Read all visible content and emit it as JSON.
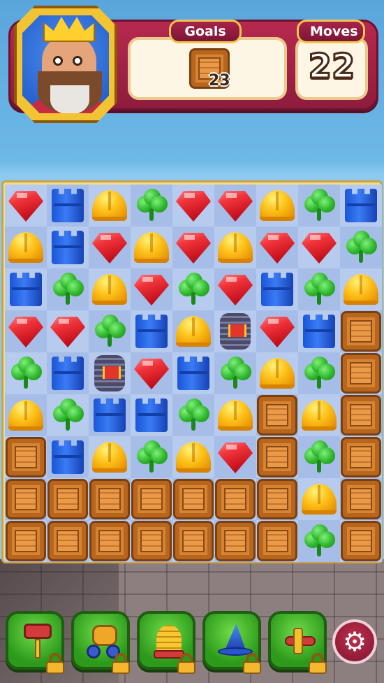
{
  "header": {
    "goals_label": "Goals",
    "moves_label": "Moves",
    "goal_count": "23",
    "moves_value": "22",
    "goal_item": "wooden-crate"
  },
  "board": {
    "legend": {
      "R": "red-gem",
      "B": "blue-tower",
      "Y": "yellow-helmet",
      "G": "green-clover",
      "K": "rocket-striped",
      "C": "wooden-crate"
    },
    "rows": [
      [
        "R",
        "B",
        "Y",
        "G",
        "R",
        "R",
        "Y",
        "G",
        "B"
      ],
      [
        "Y",
        "B",
        "R",
        "Y",
        "R",
        "Y",
        "R",
        "R",
        "G"
      ],
      [
        "B",
        "G",
        "Y",
        "R",
        "G",
        "R",
        "B",
        "G",
        "Y"
      ],
      [
        "R",
        "R",
        "G",
        "B",
        "Y",
        "K",
        "R",
        "B",
        "C"
      ],
      [
        "G",
        "B",
        "K",
        "R",
        "B",
        "G",
        "Y",
        "G",
        "C"
      ],
      [
        "Y",
        "G",
        "B",
        "B",
        "G",
        "Y",
        "C",
        "Y",
        "C"
      ],
      [
        "C",
        "B",
        "Y",
        "G",
        "Y",
        "R",
        "C",
        "G",
        "C"
      ],
      [
        "C",
        "C",
        "C",
        "C",
        "C",
        "C",
        "C",
        "Y",
        "C"
      ],
      [
        "C",
        "C",
        "C",
        "C",
        "C",
        "C",
        "C",
        "G",
        "C"
      ]
    ]
  },
  "boosters": [
    {
      "name": "hammer",
      "locked": true
    },
    {
      "name": "cannon",
      "locked": true
    },
    {
      "name": "beehive",
      "locked": true
    },
    {
      "name": "wizard-hat",
      "locked": true
    },
    {
      "name": "airplane",
      "locked": true
    }
  ],
  "settings_icon": "gear-icon",
  "colors": {
    "header": "#a8234a",
    "board_frame": "#f3dd8b",
    "booster": "#3fa52a"
  }
}
